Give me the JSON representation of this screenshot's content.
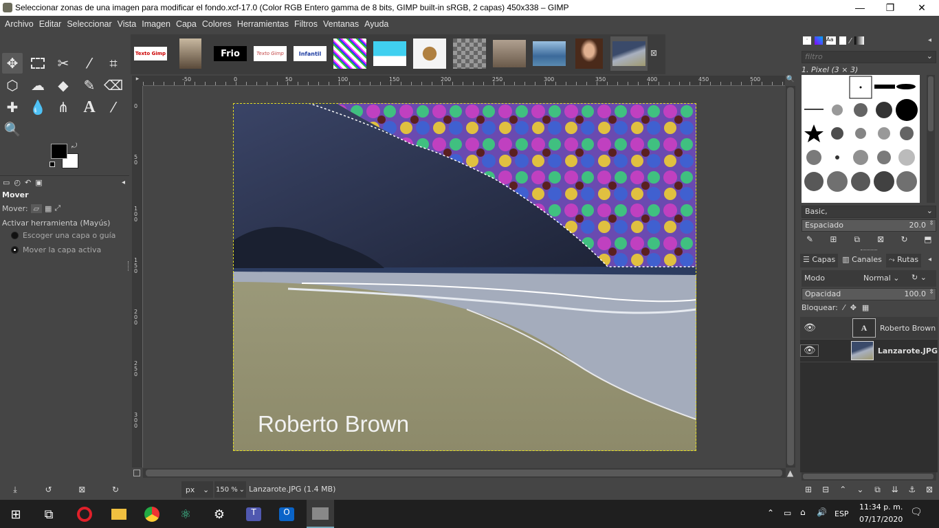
{
  "window": {
    "title": "Seleccionar zonas de una imagen para modificar el fondo.xcf-17.0 (Color RGB Entero gamma de 8 bits, GIMP built-in sRGB, 2 capas) 450x338 – GIMP",
    "minimize": "—",
    "maximize": "❐",
    "close": "✕"
  },
  "menu": [
    "Archivo",
    "Editar",
    "Seleccionar",
    "Vista",
    "Imagen",
    "Capa",
    "Colores",
    "Herramientas",
    "Filtros",
    "Ventanas",
    "Ayuda"
  ],
  "thumbnails": [
    {
      "label": "Texto Gimp",
      "bg": "#ffffff",
      "fg": "#c00000"
    },
    {
      "label": "",
      "bg": "#7a6a55"
    },
    {
      "label": "Frio",
      "bg": "#000000",
      "fg": "#ffffff"
    },
    {
      "label": "Texto Gimp",
      "bg": "#ffffff",
      "fg": "#c04040"
    },
    {
      "label": "Infantil",
      "bg": "#ffffff",
      "fg": "#1a3aa0"
    },
    {
      "label": "",
      "bg": "#50c0f0"
    },
    {
      "label": "",
      "bg": "#40d0f0"
    },
    {
      "label": "",
      "bg": "#f0f0f0"
    },
    {
      "label": "",
      "bg": "#888888"
    },
    {
      "label": "",
      "bg": "#8a7a6a"
    },
    {
      "label": "",
      "bg": "#3c6a9a"
    },
    {
      "label": "",
      "bg": "#6a4a3a"
    },
    {
      "label": "",
      "bg": "#4a5a7a"
    }
  ],
  "toolbox": {
    "tool_options": {
      "title": "Mover",
      "mover_label": "Mover:",
      "activar_label": "Activar herramienta  (Mayús)",
      "option1": "Escoger una capa o guía",
      "option2": "Mover la capa activa"
    },
    "fg_color": "#000000",
    "bg_color": "#ffffff"
  },
  "rulers": {
    "h": [
      "-50",
      "0",
      "50",
      "100",
      "150",
      "200",
      "250",
      "300",
      "350",
      "400",
      "450",
      "500"
    ],
    "v": [
      "0",
      "5 0",
      "1 0 0",
      "1 5 0",
      "2 0 0",
      "2 5 0",
      "3 0 0"
    ]
  },
  "canvas": {
    "watermark": "Roberto Brown"
  },
  "statusbar": {
    "unit": "px",
    "zoom": "150 %",
    "info": "Lanzarote.JPG (1.4 MB)"
  },
  "brushes": {
    "filter_placeholder": "filtro",
    "selected": "1. Pixel (3 × 3)",
    "preset": "Basic,",
    "spacing_label": "Espaciado",
    "spacing_value": "20.0"
  },
  "layers": {
    "tabs": [
      "Capas",
      "Canales",
      "Rutas"
    ],
    "mode_label": "Modo",
    "mode_value": "Normal",
    "opacity_label": "Opacidad",
    "opacity_value": "100.0",
    "lock_label": "Bloquear:",
    "items": [
      {
        "name": "Roberto Brown",
        "bold": false
      },
      {
        "name": "Lanzarote.JPG",
        "bold": true
      }
    ]
  },
  "taskbar": {
    "lang": "ESP",
    "time": "11:34 p. m.",
    "date": "07/17/2020"
  }
}
